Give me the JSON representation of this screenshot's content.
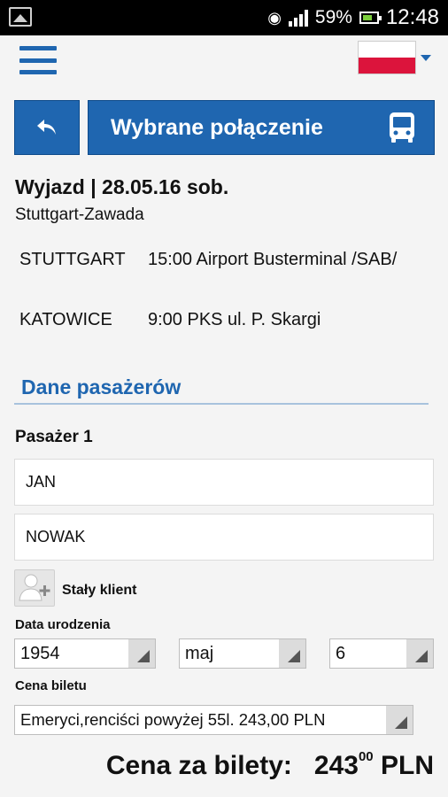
{
  "status_bar": {
    "battery": "59%",
    "time": "12:48"
  },
  "header": {
    "title": "Wybrane połączenie"
  },
  "trip": {
    "heading": "Wyjazd | 28.05.16 sob.",
    "route": "Stuttgart-Zawada",
    "stops": [
      {
        "city": "STUTTGART",
        "detail": "15:00 Airport Busterminal /SAB/"
      },
      {
        "city": "KATOWICE",
        "detail": "9:00 PKS ul. P. Skargi"
      }
    ]
  },
  "passengers": {
    "section_title": "Dane pasażerów",
    "passenger_label": "Pasażer 1",
    "first_name": "JAN",
    "last_name": "NOWAK",
    "regular_client_label": "Stały klient",
    "birth_date_label": "Data urodzenia",
    "birth_year": "1954",
    "birth_month": "maj",
    "birth_day": "6",
    "ticket_price_label": "Cena biletu",
    "ticket_price_option": "Emeryci,renciści powyżej 55l. 243,00 PLN"
  },
  "total": {
    "label": "Cena za bilety:",
    "amount_main": "243",
    "amount_fraction": "00",
    "currency": "PLN"
  },
  "colors": {
    "accent": "#1f66b0",
    "flag_white": "#ffffff",
    "flag_red": "#dc143c"
  }
}
